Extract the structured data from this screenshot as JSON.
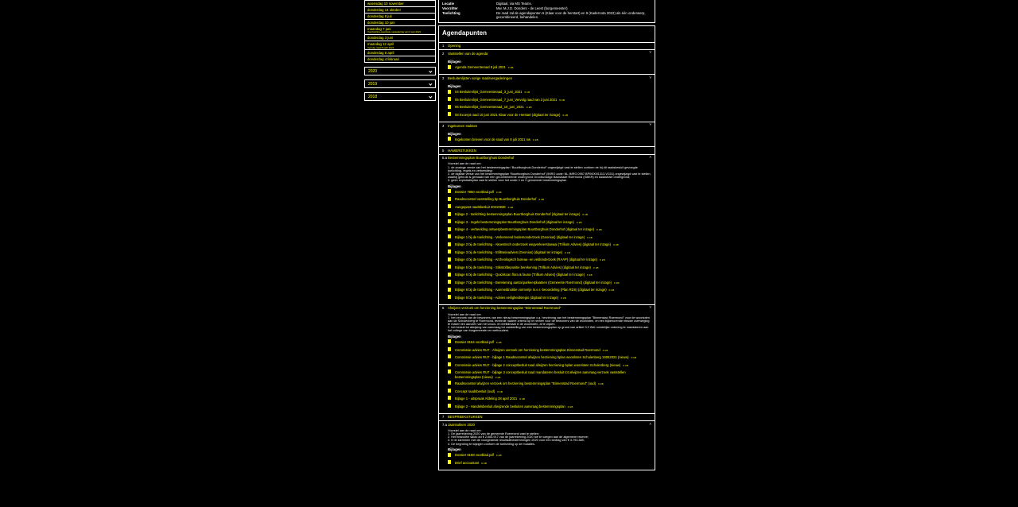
{
  "meetings": [
    {
      "label": "woensdag 10 november"
    },
    {
      "label": "donderdag 14 oktober"
    },
    {
      "label": "donderdag 8 juli"
    },
    {
      "label": "donderdag 10 juni"
    },
    {
      "label": "maandag 7 juni",
      "sub": "Voortzetting openbare vergadering van 3 juni 2021"
    },
    {
      "label": "donderdag 3 juni"
    },
    {
      "label": "maandag 12 april",
      "sub": "Vervolg raad 8 april 2021"
    },
    {
      "label": "donderdag 8 april"
    },
    {
      "label": "donderdag 4 februari"
    }
  ],
  "years": [
    "2020",
    "2019",
    "2018"
  ],
  "info": [
    {
      "key": "Locatie",
      "value": "Digitaal, via MS Teams."
    },
    {
      "key": "Voorzitter",
      "value": "Mw. M.J.D. Donders - de Leest (burgemeester)"
    },
    {
      "key": "Toelichting",
      "value": "De raad zal de agendapunten 6 (Klaar voor de herstart) en 9 (Kadernota 2022) als één onderwerp, gecombineerd, behandelen."
    }
  ],
  "agenda_title": "Agendapunten",
  "items": [
    {
      "num": "1",
      "title": "Opening",
      "icon": ""
    },
    {
      "num": "2",
      "title": "Vaststellen van de agenda",
      "icon": "˅",
      "label": "Bijlagen",
      "attachments": [
        {
          "name": "Agenda Gemeenteraad 8 juli 2021",
          "size": "0 kB"
        }
      ]
    },
    {
      "num": "3",
      "title": "Besluitenlijsten vorige raadsvergaderingen",
      "icon": "˅",
      "label": "Bijlagen",
      "attachments": [
        {
          "name": "04 Besluitenlijst_Gemeenteraad_3_juni_2021",
          "size": "0 kB"
        },
        {
          "name": "05 Besluitenlijst_Gemeenteraad_7_juni_Vervolg raad van 3 juni 2021",
          "size": "0 kB"
        },
        {
          "name": "06 Besluitenlijst_Gemeenteraad_10_juni_2021",
          "size": "0 kB"
        },
        {
          "name": "08 Excerpt raad 10 juni 2021 Klaar voor de Herstart (digitaal ter inzage)",
          "size": "0 kB"
        }
      ]
    },
    {
      "num": "4",
      "title": "Ingekomen stukken",
      "icon": "˅",
      "label": "Bijlagen",
      "attachments": [
        {
          "name": "Ingekomen brieven voor de raad van 8 juli 2021 nw",
          "size": "0 kB"
        }
      ]
    },
    {
      "num": "5",
      "title": "HAMERSTUKKEN",
      "icon": ""
    },
    {
      "num": "5.a",
      "title": "Bestemmingsplan Buurtborghuis Donderhof",
      "icon": "˄",
      "text": [
        "Voorstel aan de raad om:",
        "1. de analoge versie van het bestemmingsplan “Buurtborghuis Donderhof” ongewijzigd vast te stellen conform de bij dit raadsbesluit gevoegde toelichting, regels en verbeelding;",
        "2. de digitale versie van het bestemmingsplan “Buurtborghuis Donderhof” (IMRO code: NL.IMRO.0957.BP000001313-VG01) ongewijzigd vast te stellen, waarbij gebruik is gemaakt van een gecombineerde ondergrond Grootschalige Basiskaart Roermond (GBKR) en kadastrale ondergrond;",
        "3. geen exploitatieplan vast te stellen voor het onder 1 en 2 genoemde bestemmingsplan."
      ],
      "label": "Bijlagen",
      "attachments": [
        {
          "name": "Dossier 7850 voorblad.pdf",
          "size": "0 kB"
        },
        {
          "name": "Raadsvoorstel vaststelling bp Buurtborghuis Donderhof",
          "size": "0 kB"
        },
        {
          "name": "Aangepast raadsbesluit 20210638",
          "size": "0 kB"
        },
        {
          "name": "Bijlage 2 - toelichting bestemmingsplan Buurtborghuis Donderhof (digitaal ter inzage)",
          "size": "0 kB"
        },
        {
          "name": "Bijlage 3 - regels bestemmingsplan Buurtborghuis Donderhof (digitaal ter inzage)",
          "size": "0 kB"
        },
        {
          "name": "Bijlage 4 - verbeelding ontwerpbestemmingsplan Buurtborghuis Donderhof (digitaal ter inzage)",
          "size": "0 kB"
        },
        {
          "name": "Bijlage 1 bij de toelichting - Verkennend bodemonderzoek (Geonius) (digitaal ter inzage)",
          "size": "0 kB"
        },
        {
          "name": "Bijlage 2 bij de toelichting - Akoestisch onderzoek wegverkeerslawaai (Trillium Advies) (digitaal ter inzage)",
          "size": "0 kB"
        },
        {
          "name": "Bijlage 3 bij de toelichting - Infiltratieadvies (Geonius) (digitaal ter inzage)",
          "size": "0 kB"
        },
        {
          "name": "Bijlage 4 bij de toelichting - Archeologisch bureau- en veldonderzoek (RAAP) (digitaal ter inzage)",
          "size": "0 kB"
        },
        {
          "name": "Bijlage 5 bij de toelichting - Stikstofdepositie berekening (Trillium Advies) (digitaal ter inzage)",
          "size": "0 kB"
        },
        {
          "name": "Bijlage 6 bij de toelichting - Quickscan flora & fauna (Trillium Advies) (digitaal ter inzage)",
          "size": "0 kB"
        },
        {
          "name": "Bijlage 7 bij de toelichting - Berekening aantal parkeerplaatsen (Gemeente Roermond) (digitaal ter inzage)",
          "size": "0 kB"
        },
        {
          "name": "Bijlage 8 bij de toelichting - Aanmeldnotitie vormvrije m.e.r.-beoordeling (Plan RDS) (digitaal ter inzage)",
          "size": "0 kB"
        },
        {
          "name": "Bijlage 9 bij de toelichting - Advies veiligheidsregio (digitaal ter inzage)",
          "size": "0 kB"
        }
      ]
    },
    {
      "num": "6",
      "title": "Afwijzen verzoek om herziening bestemmingsplan \"Binnenstad Roermond\"",
      "icon": "˅",
      "text": [
        "Voorstel aan de raad om:",
        "1. het verzoek van de bewoners van een nieuw bestemmingsplan c.q. herziening van het bestemmingsplan \"Binnenstad Roermond\" voor de woonloten aan de Schulenberg te Roermond, teneinde nadere criteria op te nemen voor de bewoners van de woonloten, en een bijbehorende nieuwe overweging te maken ten aanzien van het woon- en leefklimaat in de woonloten, af te wijzen.",
        "2. het besluit tot afwijzing van aanvraag tot vaststelling van een bestemmingsplan op grond van artikel 3.9 Wet ruimtelijke ordening te mandateren aan het college van burgemeester en wethouders."
      ],
      "label": "Bijlagen",
      "attachments": [
        {
          "name": "Dossier 8164 voorblad.pdf",
          "size": "0 kB"
        },
        {
          "name": "Commissie advies RU7 - Afwijzen verzoek om herziening bestemmingsplan Binnenstad Roermond",
          "size": "0 kB"
        },
        {
          "name": "Commissie advies RU7 - bijlage 1 Raadsvoorstel afwijzen herziening bplan woonloten Schulenberg 19052021 (nieuw)",
          "size": "0 kB"
        },
        {
          "name": "Commissie advies RU7 - bijlage 2 conceptbesluit raad afwijzen herziening bplan woonloten Schulenberg (nieuw)",
          "size": "0 kB"
        },
        {
          "name": "Commissie advies RU7 - bijlage 3 conceptbesluit raad mandateren besluit tot afwijzen aanvraag verzoek vaststellen bestemmingsplan (nieuw)",
          "size": "0 kB",
          "tall": true
        },
        {
          "name": "Raadsvoorstel afwijzen verzoek om herziening bestemmingsplan \"Binnenstad Roermond\" (oud)",
          "size": "0 kB"
        },
        {
          "name": "Concept raadsbesluit (oud)",
          "size": "0 kB"
        },
        {
          "name": "Bijlage 1 - uitspraak Afdeling 28 april 2021",
          "size": "0 kB"
        },
        {
          "name": "Bijlage 2 - Handelsbesluit afwijzende besluiten aanvraag bestemmingsplan",
          "size": "0 kB"
        }
      ]
    },
    {
      "num": "7",
      "title": "BESPREEKSTUKKEN",
      "icon": ""
    },
    {
      "num": "7.a",
      "title": "Jaarstukken 2020",
      "icon": "˄",
      "text": [
        "Voorstel aan de raad om:",
        "1. De jaarrekening 2020 van de gemeente Roermond vast te stellen;",
        "2. Het financiële saldo ad € 2.665.917 van de jaarrekening 2020 toe te voegen aan de algemene reserve;",
        "3. In te stemmen met de voorgestelde resultaatbestemmingen 2020 voor een bedrag van € 3.793.385;",
        "4. De begroting te wijzigen conform de toelichting op de mutaties."
      ],
      "label": "Bijlagen",
      "attachments": [
        {
          "name": "Dossier 8188 voorblad.pdf",
          "size": "0 kB"
        },
        {
          "name": "Brief accountant",
          "size": "0 kB"
        }
      ]
    }
  ]
}
